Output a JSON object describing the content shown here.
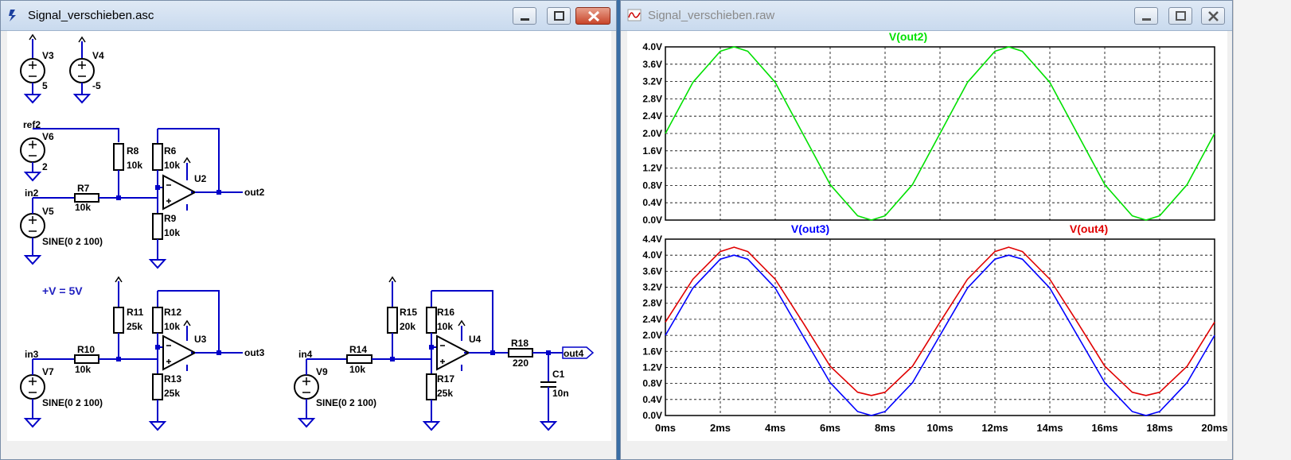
{
  "left_window": {
    "title": "Signal_verschieben.asc",
    "buttons": [
      "minimize",
      "maximize",
      "close"
    ]
  },
  "right_window": {
    "title": "Signal_verschieben.raw",
    "buttons": [
      "minimize",
      "maximize",
      "close"
    ]
  },
  "schematic": {
    "labels": [
      {
        "id": "v3",
        "text": "V3"
      },
      {
        "id": "v3val",
        "text": "5"
      },
      {
        "id": "v4",
        "text": "V4"
      },
      {
        "id": "v4val",
        "text": "-5"
      },
      {
        "id": "ref2",
        "text": "ref2"
      },
      {
        "id": "v6",
        "text": "V6"
      },
      {
        "id": "v6val",
        "text": "2"
      },
      {
        "id": "r8",
        "text": "R8"
      },
      {
        "id": "r8val",
        "text": "10k"
      },
      {
        "id": "r6",
        "text": "R6"
      },
      {
        "id": "r6val",
        "text": "10k"
      },
      {
        "id": "u2",
        "text": "U2"
      },
      {
        "id": "in2",
        "text": "in2"
      },
      {
        "id": "r7",
        "text": "R7"
      },
      {
        "id": "r7val",
        "text": "10k"
      },
      {
        "id": "out2",
        "text": "out2"
      },
      {
        "id": "v5",
        "text": "V5"
      },
      {
        "id": "v5val",
        "text": "SINE(0 2 100)"
      },
      {
        "id": "r9",
        "text": "R9"
      },
      {
        "id": "r9val",
        "text": "10k"
      },
      {
        "id": "directive",
        "text": "+V = 5V"
      },
      {
        "id": "r11",
        "text": "R11"
      },
      {
        "id": "r11val",
        "text": "25k"
      },
      {
        "id": "r12",
        "text": "R12"
      },
      {
        "id": "r12val",
        "text": "10k"
      },
      {
        "id": "u3",
        "text": "U3"
      },
      {
        "id": "in3",
        "text": "in3"
      },
      {
        "id": "r10",
        "text": "R10"
      },
      {
        "id": "r10val",
        "text": "10k"
      },
      {
        "id": "out3",
        "text": "out3"
      },
      {
        "id": "v7",
        "text": "V7"
      },
      {
        "id": "v7val",
        "text": "SINE(0 2 100)"
      },
      {
        "id": "r13",
        "text": "R13"
      },
      {
        "id": "r13val",
        "text": "25k"
      },
      {
        "id": "r15",
        "text": "R15"
      },
      {
        "id": "r15val",
        "text": "20k"
      },
      {
        "id": "r16",
        "text": "R16"
      },
      {
        "id": "r16val",
        "text": "10k"
      },
      {
        "id": "u4",
        "text": "U4"
      },
      {
        "id": "in4",
        "text": "in4"
      },
      {
        "id": "r14",
        "text": "R14"
      },
      {
        "id": "r14val",
        "text": "10k"
      },
      {
        "id": "r18",
        "text": "R18"
      },
      {
        "id": "r18val",
        "text": "220"
      },
      {
        "id": "out4",
        "text": "out4"
      },
      {
        "id": "v9",
        "text": "V9"
      },
      {
        "id": "v9val",
        "text": "SINE(0 2 100)"
      },
      {
        "id": "r17",
        "text": "R17"
      },
      {
        "id": "r17val",
        "text": "25k"
      },
      {
        "id": "c1",
        "text": "C1"
      },
      {
        "id": "c1val",
        "text": "10n"
      }
    ]
  },
  "chart_data": [
    {
      "type": "line",
      "title": "V(out2)",
      "x_ticks": [
        "0ms",
        "2ms",
        "4ms",
        "6ms",
        "8ms",
        "10ms",
        "12ms",
        "14ms",
        "16ms",
        "18ms",
        "20ms"
      ],
      "y_ticks": [
        "0.0V",
        "0.4V",
        "0.8V",
        "1.2V",
        "1.6V",
        "2.0V",
        "2.4V",
        "2.8V",
        "3.2V",
        "3.6V",
        "4.0V"
      ],
      "xlim": [
        0,
        20
      ],
      "ylim": [
        0,
        4.0
      ],
      "grid": true,
      "series": [
        {
          "name": "V(out2)",
          "color": "#00e000",
          "x": [
            0,
            1,
            2,
            2.5,
            3,
            4,
            5,
            6,
            7,
            7.5,
            8,
            9,
            10,
            11,
            12,
            12.5,
            13,
            14,
            15,
            16,
            17,
            17.5,
            18,
            19,
            20
          ],
          "y": [
            2.0,
            3.18,
            3.9,
            4.0,
            3.9,
            3.18,
            2.0,
            0.82,
            0.1,
            0.0,
            0.1,
            0.82,
            2.0,
            3.18,
            3.9,
            4.0,
            3.9,
            3.18,
            2.0,
            0.82,
            0.1,
            0.0,
            0.1,
            0.82,
            2.0
          ]
        }
      ]
    },
    {
      "type": "line",
      "x_ticks": [
        "0ms",
        "2ms",
        "4ms",
        "6ms",
        "8ms",
        "10ms",
        "12ms",
        "14ms",
        "16ms",
        "18ms",
        "20ms"
      ],
      "y_ticks": [
        "0.0V",
        "0.4V",
        "0.8V",
        "1.2V",
        "1.6V",
        "2.0V",
        "2.4V",
        "2.8V",
        "3.2V",
        "3.6V",
        "4.0V",
        "4.4V"
      ],
      "xlim": [
        0,
        20
      ],
      "ylim": [
        0,
        4.4
      ],
      "grid": true,
      "series": [
        {
          "name": "V(out3)",
          "color": "#0000ff",
          "x": [
            0,
            1,
            2,
            2.5,
            3,
            4,
            5,
            6,
            7,
            7.5,
            8,
            9,
            10,
            11,
            12,
            12.5,
            13,
            14,
            15,
            16,
            17,
            17.5,
            18,
            19,
            20
          ],
          "y": [
            2.0,
            3.18,
            3.9,
            4.0,
            3.9,
            3.18,
            2.0,
            0.82,
            0.1,
            0.0,
            0.1,
            0.82,
            2.0,
            3.18,
            3.9,
            4.0,
            3.9,
            3.18,
            2.0,
            0.82,
            0.1,
            0.0,
            0.1,
            0.82,
            2.0
          ]
        },
        {
          "name": "V(out4)",
          "color": "#e00000",
          "x": [
            0,
            1,
            2,
            2.5,
            3,
            4,
            5,
            6,
            7,
            7.5,
            8,
            9,
            10,
            11,
            12,
            12.5,
            13,
            14,
            15,
            16,
            17,
            17.5,
            18,
            19,
            20
          ],
          "y": [
            2.33,
            3.4,
            4.09,
            4.2,
            4.09,
            3.4,
            2.33,
            1.23,
            0.58,
            0.5,
            0.58,
            1.23,
            2.33,
            3.4,
            4.09,
            4.2,
            4.09,
            3.4,
            2.33,
            1.23,
            0.58,
            0.5,
            0.58,
            1.23,
            2.33
          ]
        }
      ]
    }
  ],
  "colors": {
    "wire": "#0000c8",
    "component": "#000000",
    "label": "#000000",
    "grid": "#000000"
  }
}
